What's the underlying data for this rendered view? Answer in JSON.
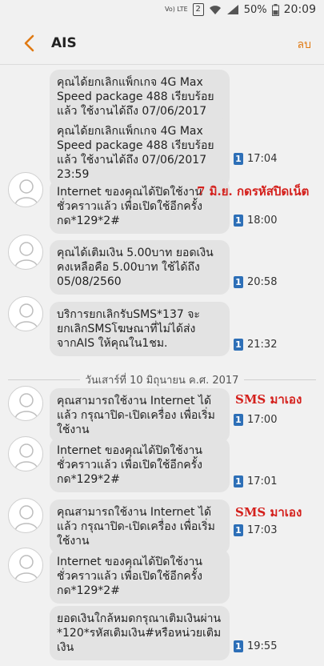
{
  "status": {
    "carrier": "Vo) LTE",
    "sim_slot": "2",
    "battery": "50%",
    "time": "20:09"
  },
  "header": {
    "title": "AIS",
    "action_label": "ลบ"
  },
  "messages": [
    {
      "text": "คุณได้ยกเลิกแพ็กเกจ 4G Max Speed package 488 เรียบร้อยแล้ว ใช้งานได้ถึง 07/06/2017 17:02",
      "sim": "1",
      "time": ""
    },
    {
      "text": "คุณได้ยกเลิกแพ็กเกจ 4G Max Speed package 488 เรียบร้อยแล้ว ใช้งานได้ถึง 07/06/2017 23:59",
      "sim": "1",
      "time": "17:04"
    },
    {
      "text": "Internet ของคุณได้ปิดใช้งานชั่วคราวแล้ว เพื่อเปิดใช้อีกครั้ง กด*129*2#",
      "sim": "1",
      "time": "18:00"
    },
    {
      "text": "คุณได้เติมเงิน 5.00บาท ยอดเงินคงเหลือคือ 5.00บาท ใช้ได้ถึง 05/08/2560",
      "sim": "1",
      "time": "20:58"
    },
    {
      "text": "บริการยกเลิกรับSMS*137 จะยกเลิกSMSโฆษณาที่ไม่ได้ส่งจากAIS ให้คุณใน1ชม.",
      "sim": "1",
      "time": "21:32"
    },
    {
      "text": "คุณสามารถใช้งาน Internet ได้แล้ว กรุณาปิด-เปิดเครื่อง เพื่อเริ่มใช้งาน",
      "sim": "1",
      "time": "17:00"
    },
    {
      "text": "Internet ของคุณได้ปิดใช้งานชั่วคราวแล้ว เพื่อเปิดใช้อีกครั้ง กด*129*2#",
      "sim": "1",
      "time": "17:01"
    },
    {
      "text": "คุณสามารถใช้งาน Internet ได้แล้ว กรุณาปิด-เปิดเครื่อง เพื่อเริ่มใช้งาน",
      "sim": "1",
      "time": "17:03"
    },
    {
      "text": "Internet ของคุณได้ปิดใช้งานชั่วคราวแล้ว เพื่อเปิดใช้อีกครั้ง กด*129*2#",
      "sim": "",
      "time": ""
    },
    {
      "text": "ยอดเงินใกล้หมดกรุณาเติมเงินผ่าน *120*รหัสเติมเงิน#หรือหน่วยเติมเงิน",
      "sim": "1",
      "time": "19:55"
    }
  ],
  "date_divider": "วันเสาร์ที่ 10 มิถุนายน ค.ศ. 2017",
  "annotations": {
    "note_1": "7 มิ.ย. กดรหัสปิดเน็ต",
    "note_2": "SMS มาเอง",
    "note_3": "SMS มาเอง",
    "color": "#d4201c"
  }
}
